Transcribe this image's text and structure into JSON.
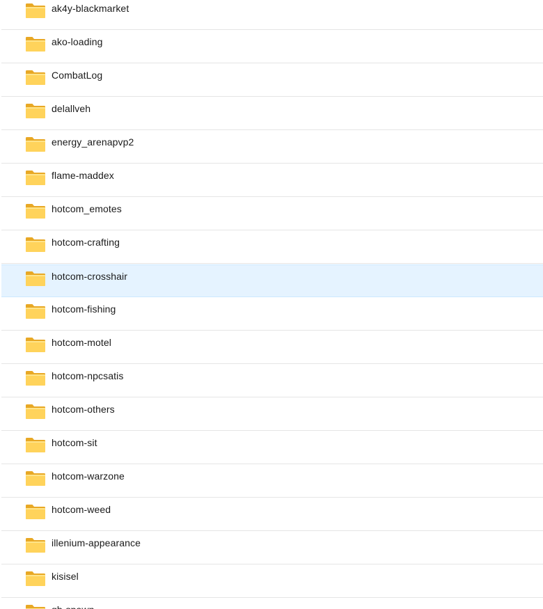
{
  "file_list": {
    "icon": "folder-icon",
    "selected_index": 8,
    "accent_selected_bg": "#e5f3ff",
    "items": [
      {
        "name": "ak4y-blackmarket"
      },
      {
        "name": "ako-loading"
      },
      {
        "name": "CombatLog"
      },
      {
        "name": "delallveh"
      },
      {
        "name": "energy_arenapvp2"
      },
      {
        "name": "flame-maddex"
      },
      {
        "name": "hotcom_emotes"
      },
      {
        "name": "hotcom-crafting"
      },
      {
        "name": "hotcom-crosshair"
      },
      {
        "name": "hotcom-fishing"
      },
      {
        "name": "hotcom-motel"
      },
      {
        "name": "hotcom-npcsatis"
      },
      {
        "name": "hotcom-others"
      },
      {
        "name": "hotcom-sit"
      },
      {
        "name": "hotcom-warzone"
      },
      {
        "name": "hotcom-weed"
      },
      {
        "name": "illenium-appearance"
      },
      {
        "name": "kisisel"
      },
      {
        "name": "qb-spawn"
      }
    ]
  }
}
